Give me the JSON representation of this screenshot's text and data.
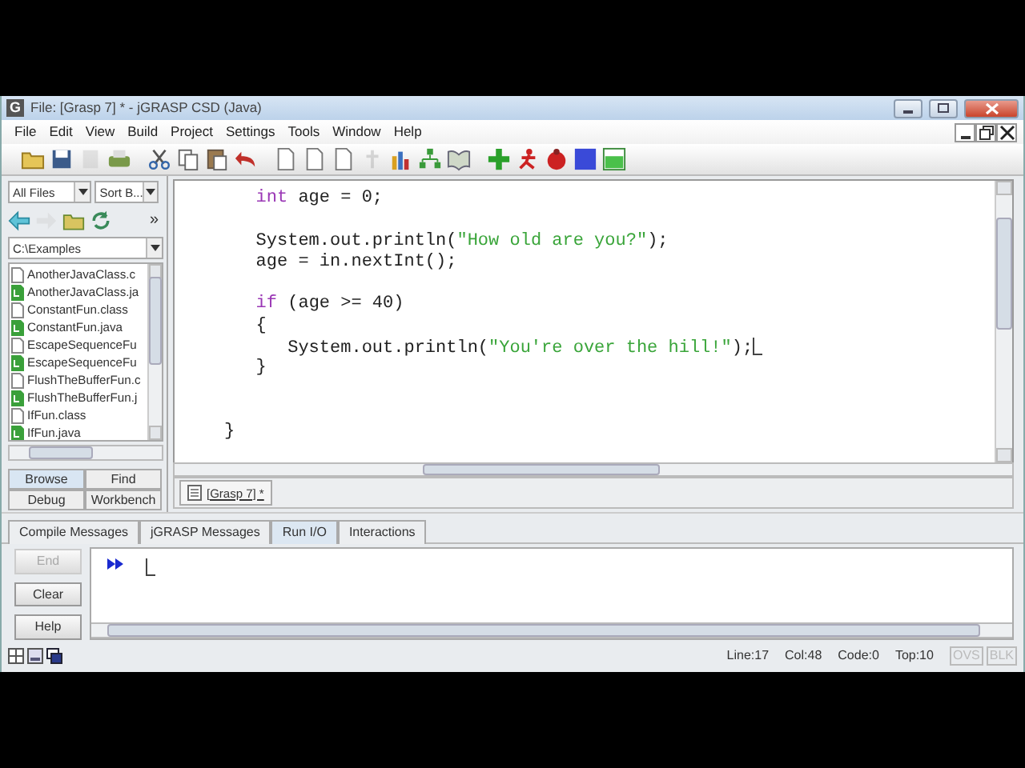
{
  "window": {
    "logo": "G",
    "title": "File: [Grasp 7] * - jGRASP CSD (Java)"
  },
  "menu": [
    "File",
    "Edit",
    "View",
    "Build",
    "Project",
    "Settings",
    "Tools",
    "Window",
    "Help"
  ],
  "toolbar": [
    {
      "kind": "folder",
      "disabled": false
    },
    {
      "kind": "floppy",
      "disabled": false
    },
    {
      "kind": "page",
      "disabled": true
    },
    {
      "kind": "printer",
      "disabled": false
    },
    {
      "kind": "scissors",
      "disabled": false
    },
    {
      "kind": "copy",
      "disabled": false
    },
    {
      "kind": "clipboard",
      "disabled": false
    },
    {
      "kind": "undo",
      "disabled": false
    },
    {
      "kind": "document",
      "disabled": false
    },
    {
      "kind": "document",
      "disabled": false
    },
    {
      "kind": "document",
      "disabled": false
    },
    {
      "kind": "pin",
      "disabled": true
    },
    {
      "kind": "chart",
      "disabled": false
    },
    {
      "kind": "tree",
      "disabled": false
    },
    {
      "kind": "book",
      "disabled": false
    },
    {
      "kind": "plus",
      "disabled": false
    },
    {
      "kind": "runner",
      "disabled": false
    },
    {
      "kind": "bug",
      "disabled": false
    },
    {
      "kind": "square",
      "disabled": false
    },
    {
      "kind": "panel",
      "disabled": false
    }
  ],
  "browser": {
    "filter": "All Files",
    "sort": "Sort B...",
    "nav": [
      {
        "kind": "back",
        "disabled": false
      },
      {
        "kind": "forward",
        "disabled": true
      },
      {
        "kind": "folder",
        "disabled": false
      },
      {
        "kind": "refresh",
        "disabled": false
      }
    ],
    "overflow": "»",
    "path": "C:\\Examples",
    "files": [
      {
        "name": "AnotherJavaClass.c",
        "kind": "class"
      },
      {
        "name": "AnotherJavaClass.ja",
        "kind": "java"
      },
      {
        "name": "ConstantFun.class",
        "kind": "class"
      },
      {
        "name": "ConstantFun.java",
        "kind": "java"
      },
      {
        "name": "EscapeSequenceFu",
        "kind": "class"
      },
      {
        "name": "EscapeSequenceFu",
        "kind": "java"
      },
      {
        "name": "FlushTheBufferFun.c",
        "kind": "class"
      },
      {
        "name": "FlushTheBufferFun.j",
        "kind": "java"
      },
      {
        "name": "IfFun.class",
        "kind": "class"
      },
      {
        "name": "IfFun.java",
        "kind": "java"
      }
    ],
    "tabs": [
      {
        "label": "Browse",
        "selected": true
      },
      {
        "label": "Find",
        "selected": false
      },
      {
        "label": "Debug",
        "selected": false
      },
      {
        "label": "Workbench",
        "selected": false
      }
    ]
  },
  "editor": {
    "lines": [
      {
        "kind": "code",
        "caret": false,
        "parts": [
          {
            "kind": "keyword",
            "text": "   int"
          },
          {
            "kind": "plain",
            "text": " age = 0;"
          }
        ]
      },
      {
        "kind": "blank"
      },
      {
        "kind": "code",
        "caret": false,
        "parts": [
          {
            "kind": "plain",
            "text": "   System.out.println("
          },
          {
            "kind": "string",
            "text": "\"How old are you?\""
          },
          {
            "kind": "plain",
            "text": ");"
          }
        ]
      },
      {
        "kind": "code",
        "caret": false,
        "parts": [
          {
            "kind": "plain",
            "text": "   age = in.nextInt();"
          }
        ]
      },
      {
        "kind": "blank"
      },
      {
        "kind": "code",
        "caret": false,
        "parts": [
          {
            "kind": "keyword",
            "text": "   if"
          },
          {
            "kind": "plain",
            "text": " (age >= 40)"
          }
        ]
      },
      {
        "kind": "code",
        "caret": false,
        "parts": [
          {
            "kind": "plain",
            "text": "   {"
          }
        ]
      },
      {
        "kind": "code",
        "caret": true,
        "parts": [
          {
            "kind": "plain",
            "text": "      System.out.println("
          },
          {
            "kind": "string",
            "text": "\"You're over the hill!\""
          },
          {
            "kind": "plain",
            "text": ");"
          }
        ]
      },
      {
        "kind": "code",
        "caret": false,
        "parts": [
          {
            "kind": "plain",
            "text": "   }"
          }
        ]
      },
      {
        "kind": "blank"
      },
      {
        "kind": "blank"
      },
      {
        "kind": "code",
        "caret": false,
        "parts": [
          {
            "kind": "plain",
            "text": "}"
          }
        ]
      }
    ],
    "tab": "[Grasp 7] *"
  },
  "io": {
    "tabs": [
      {
        "label": "Compile Messages",
        "selected": false
      },
      {
        "label": "jGRASP Messages",
        "selected": false
      },
      {
        "label": "Run I/O",
        "selected": true
      },
      {
        "label": "Interactions",
        "selected": false
      }
    ],
    "buttons": [
      {
        "label": "End",
        "disabled": true
      },
      {
        "label": "Clear",
        "disabled": false
      },
      {
        "label": "Help",
        "disabled": false
      }
    ],
    "caret": true
  },
  "status": {
    "items": [
      "Line:17",
      "Col:48",
      "Code:0",
      "Top:10"
    ],
    "flags": [
      {
        "label": "OVS",
        "on": false
      },
      {
        "label": "BLK",
        "on": false
      }
    ]
  }
}
